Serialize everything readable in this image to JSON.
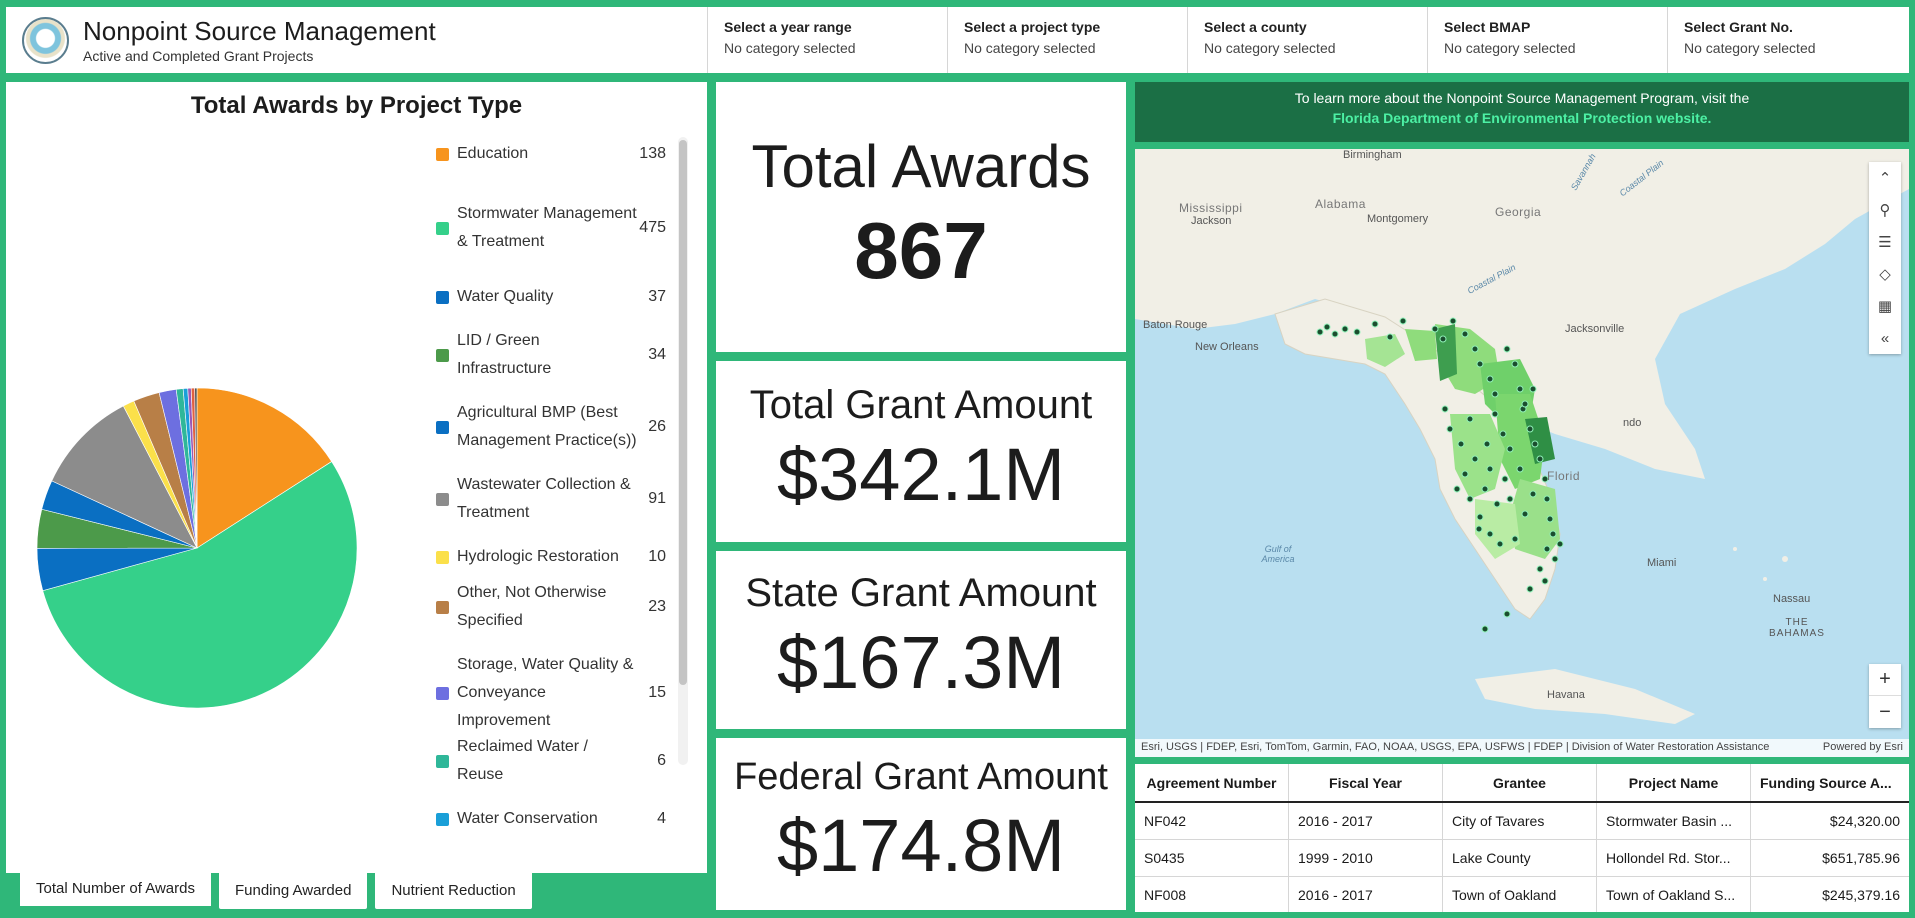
{
  "header": {
    "title": "Nonpoint Source Management",
    "subtitle": "Active and Completed Grant Projects",
    "filters": [
      {
        "label": "Select a year range",
        "value": "No category selected"
      },
      {
        "label": "Select a project type",
        "value": "No category selected"
      },
      {
        "label": "Select a county",
        "value": "No category selected"
      },
      {
        "label": "Select BMAP",
        "value": "No category selected"
      },
      {
        "label": "Select Grant No.",
        "value": "No category selected"
      }
    ]
  },
  "chart_data": {
    "type": "pie",
    "title": "Total Awards by Project Type",
    "slices": [
      {
        "label": "Education",
        "value": 138,
        "color": "#f7941d"
      },
      {
        "label": "Stormwater Management & Treatment",
        "value": 475,
        "color": "#35d08a"
      },
      {
        "label": "Water Quality",
        "value": 37,
        "color": "#0a6fc2"
      },
      {
        "label": "LID / Green Infrastructure",
        "value": 34,
        "color": "#4c9a4a"
      },
      {
        "label": "Agricultural BMP (Best Management Practice(s))",
        "value": 26,
        "color": "#0a6fc2"
      },
      {
        "label": "Wastewater Collection & Treatment",
        "value": 91,
        "color": "#8c8c8c"
      },
      {
        "label": "Hydrologic Restoration",
        "value": 10,
        "color": "#fbe04a"
      },
      {
        "label": "Other, Not Otherwise Specified",
        "value": 23,
        "color": "#b87f47"
      },
      {
        "label": "Storage, Water Quality & Conveyance Improvement",
        "value": 15,
        "color": "#6d6fe0"
      },
      {
        "label": "Reclaimed Water / Reuse",
        "value": 6,
        "color": "#2fb799"
      },
      {
        "label": "Water Conservation",
        "value": 4,
        "color": "#1a9fd8"
      },
      {
        "label": "",
        "value": 3,
        "color": "#9b59b6"
      },
      {
        "label": "",
        "value": 3,
        "color": "#e06040"
      },
      {
        "label": "",
        "value": 2,
        "color": "#555555"
      }
    ]
  },
  "tabs": [
    "Total Number of Awards",
    "Funding Awarded",
    "Nutrient Reduction"
  ],
  "stats": {
    "awards_title": "Total Awards",
    "awards_value": "867",
    "grant_title": "Total Grant Amount",
    "grant_value": "$342.1M",
    "state_title": "State Grant Amount",
    "state_value": "$167.3M",
    "federal_title": "Federal Grant Amount",
    "federal_value": "$174.8M"
  },
  "info": {
    "text": "To learn more about the Nonpoint Source Management Program, visit the",
    "link": "Florida Department of Environmental Protection website."
  },
  "map": {
    "labels": {
      "birmingham": "Birmingham",
      "mississippi": "Mississippi",
      "jackson": "Jackson",
      "alabama": "Alabama",
      "montgomery": "Montgomery",
      "georgia": "Georgia",
      "savannah": "Savannah",
      "coastal_plain_1": "Coastal Plain",
      "coastal_plain_2": "Coastal Plain",
      "baton_rouge": "Baton Rouge",
      "new_orleans": "New Orleans",
      "jacksonville": "Jacksonville",
      "orlando": "ndo",
      "florida": "Florid",
      "gulf": "Gulf of America",
      "miami": "Miami",
      "nassau": "Nassau",
      "bahamas": "THE BAHAMAS",
      "havana": "Havana"
    },
    "attribution": "Esri, USGS | FDEP, Esri, TomTom, Garmin, FAO, NOAA, USGS, EPA, USFWS | FDEP | Division of Water Restoration Assistance",
    "powered": "Powered by Esri",
    "tools": [
      "collapse-up-icon",
      "search-icon",
      "list-icon",
      "layers-icon",
      "qr-icon",
      "collapse-left-icon"
    ]
  },
  "table": {
    "headers": [
      "Agreement Number",
      "Fiscal Year",
      "Grantee",
      "Project Name",
      "Funding Source A..."
    ],
    "rows": [
      [
        "NF042",
        "2016 - 2017",
        "City of Tavares",
        "Stormwater Basin ...",
        "$24,320.00"
      ],
      [
        "S0435",
        "1999 - 2010",
        "Lake County",
        "Hollondel Rd. Stor...",
        "$651,785.96"
      ],
      [
        "NF008",
        "2016 - 2017",
        "Town of Oakland",
        "Town of Oakland S...",
        "$245,379.16"
      ]
    ]
  }
}
